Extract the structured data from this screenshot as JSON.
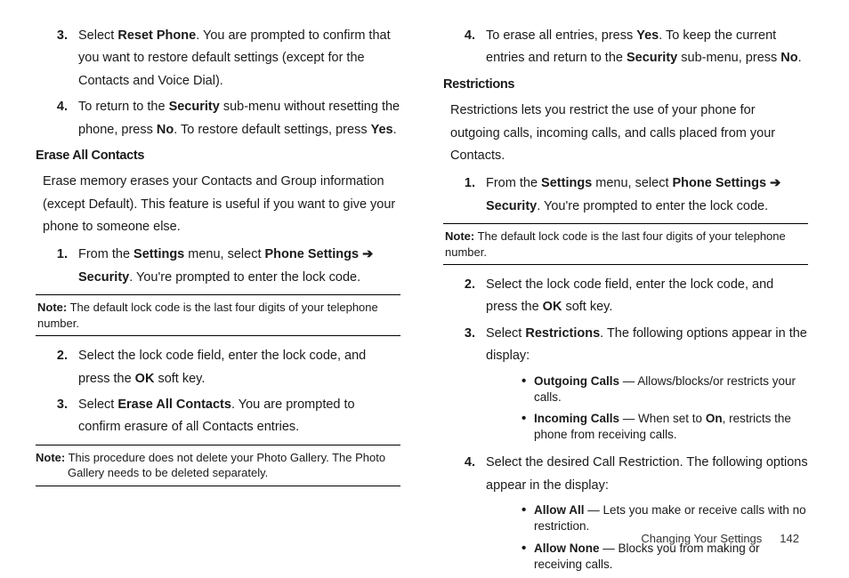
{
  "col1": {
    "step3_a": "Select ",
    "step3_b": "Reset Phone",
    "step3_c": ". You are prompted to confirm that you want to restore default settings (except for the Contacts and Voice Dial).",
    "step4_a": "To return to the ",
    "step4_b": "Security",
    "step4_c": " sub-menu without resetting the phone, press ",
    "step4_d": "No",
    "step4_e": ". To restore default settings, press ",
    "step4_f": "Yes",
    "step4_g": ".",
    "heading_erase": "Erase All Contacts",
    "erase_para": "Erase memory erases your Contacts and Group information (except Default). This feature is useful if you want to give your phone to someone else.",
    "e1_a": "From the ",
    "e1_b": "Settings",
    "e1_c": " menu, select ",
    "e1_d": "Phone Settings",
    "e1_e": " ",
    "e1_f": "Security",
    "e1_g": ". You're prompted to enter the lock code.",
    "note1_label": "Note:",
    "note1_body": " The default lock code is the last four digits of your telephone number.",
    "e2_a": "Select the lock code field, enter the lock code, and press the ",
    "e2_b": "OK",
    "e2_c": " soft key.",
    "e3_a": "Select ",
    "e3_b": "Erase All Contacts",
    "e3_c": ". You are prompted to confirm erasure of all Contacts entries.",
    "note2_label": "Note:",
    "note2_body": " This procedure does not delete your Photo Gallery. The Photo Gallery needs to be deleted separately."
  },
  "col2": {
    "s4_a": "To erase all entries, press ",
    "s4_b": "Yes",
    "s4_c": ". To keep the current entries and return to the ",
    "s4_d": "Security",
    "s4_e": " sub-menu, press ",
    "s4_f": "No",
    "s4_g": ".",
    "heading_restrict": "Restrictions",
    "restrict_para": "Restrictions lets you restrict the use of your phone for outgoing calls, incoming calls, and calls placed from your Contacts.",
    "r1_a": "From the ",
    "r1_b": "Settings",
    "r1_c": " menu, select ",
    "r1_d": "Phone Settings",
    "r1_e": " ",
    "r1_f": "Security",
    "r1_g": ". You're prompted to enter the lock code.",
    "note3_label": "Note:",
    "note3_body": " The default lock code is the last four digits of your telephone number.",
    "r2_a": "Select the lock code field, enter the lock code, and press the ",
    "r2_b": "OK",
    "r2_c": " soft key.",
    "r3_a": "Select ",
    "r3_b": "Restrictions",
    "r3_c": ". The following options appear in the display:",
    "r3_ba_b": "Outgoing Calls",
    "r3_ba_t": " — Allows/blocks/or restricts your calls.",
    "r3_bb_b": "Incoming Calls",
    "r3_bb_t1": " — When set to ",
    "r3_bb_on": "On",
    "r3_bb_t2": ", restricts the phone from receiving calls.",
    "r4": "Select the desired Call Restriction. The following options appear in the display:",
    "r4_ba_b": "Allow All",
    "r4_ba_t": " — Lets you make or receive calls with no restriction.",
    "r4_bb_b": "Allow None",
    "r4_bb_t": " — Blocks you from making or receiving calls."
  },
  "footer": {
    "section": "Changing Your Settings",
    "page": "142"
  },
  "nums": {
    "n1": "1.",
    "n2": "2.",
    "n3": "3.",
    "n4": "4."
  },
  "arrow": "➔"
}
